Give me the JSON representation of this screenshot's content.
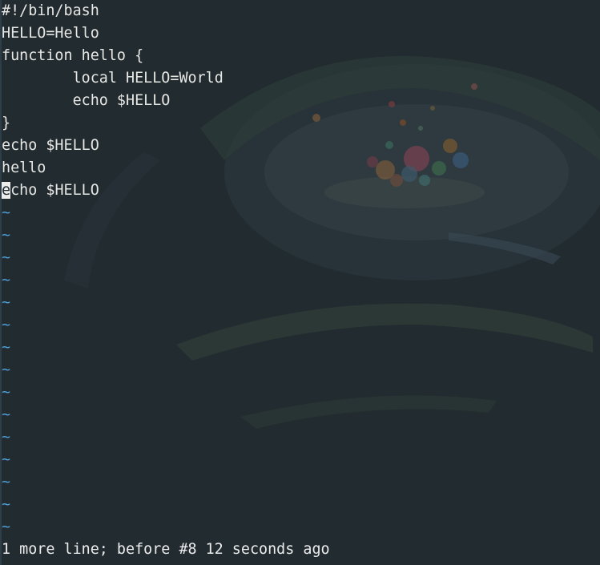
{
  "editor": {
    "buffer_lines": [
      "#!/bin/bash",
      "HELLO=Hello",
      "function hello {",
      "        local HELLO=World",
      "        echo $HELLO",
      "}",
      "echo $HELLO",
      "hello"
    ],
    "cursor_line": {
      "cursor_char": "e",
      "rest": "cho $HELLO"
    },
    "empty_line_marker": "~",
    "empty_line_count": 15,
    "text_color": "#e7e7e4",
    "tilde_color": "#4d9fd6",
    "background_color": "#222b30"
  },
  "status_bar": {
    "message": "1 more line; before #8",
    "time": "12 seconds ago"
  }
}
